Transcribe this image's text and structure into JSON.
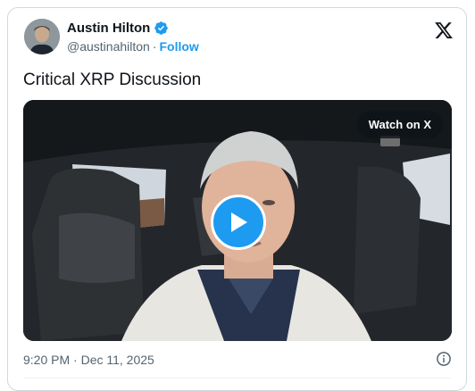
{
  "author": {
    "name": "Austin Hilton",
    "handle": "@austinahilton",
    "separator": "·",
    "follow_label": "Follow",
    "verified": true,
    "verified_color": "#1d9bf0"
  },
  "platform_icon": "x-logo-icon",
  "tweet": {
    "text": "Critical XRP Discussion"
  },
  "media": {
    "watch_label": "Watch on X",
    "play_icon": "play-icon",
    "play_color": "#1d9bf0"
  },
  "footer": {
    "timestamp": "9:20 PM · Dec 11, 2025",
    "info_icon": "info-icon"
  }
}
